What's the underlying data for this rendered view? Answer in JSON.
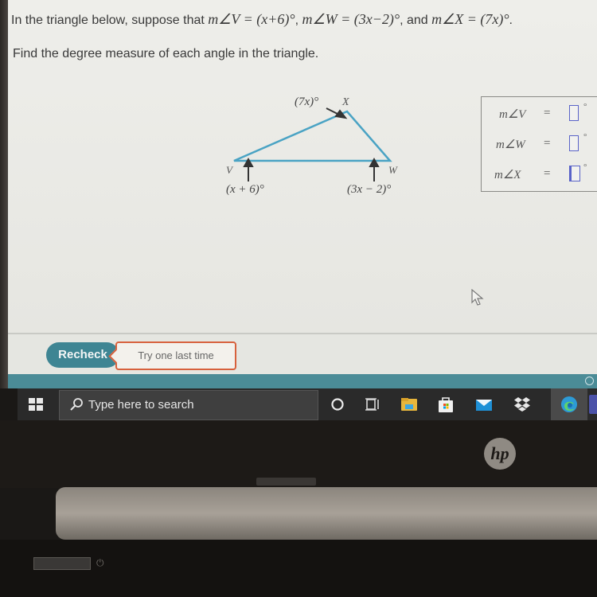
{
  "problem": {
    "intro": "In the triangle below, suppose that ",
    "angle_v_expr": "m∠V = (x+6)°",
    "sep1": ", ",
    "angle_w_expr": "m∠W = (3x−2)°",
    "sep2": ", and ",
    "angle_x_expr": "m∠X = (7x)°",
    "end": ".",
    "instruction": "Find the degree measure of each angle in the triangle."
  },
  "diagram": {
    "vertex_v": "V",
    "vertex_w": "W",
    "vertex_x": "X",
    "label_v": "(x + 6)°",
    "label_w": "(3x − 2)°",
    "label_x": "(7x)°",
    "line_color": "#4aa3c4"
  },
  "answers": [
    {
      "label": "m∠V",
      "eq": "=",
      "value": "",
      "unit": "°"
    },
    {
      "label": "m∠W",
      "eq": "=",
      "value": "",
      "unit": "°"
    },
    {
      "label": "m∠X",
      "eq": "=",
      "value": "",
      "unit": "°"
    }
  ],
  "footer": {
    "recheck_label": "Recheck",
    "feedback": "Try one last time",
    "accent": "#3e8593",
    "feedback_border": "#d7613d"
  },
  "taskbar": {
    "search_placeholder": "Type here to search",
    "icons": [
      "cortana-icon",
      "task-view-icon",
      "file-explorer-icon",
      "microsoft-store-icon",
      "mail-icon",
      "dropbox-icon",
      "edge-icon",
      "teams-icon"
    ]
  },
  "device": {
    "brand": "hp"
  }
}
